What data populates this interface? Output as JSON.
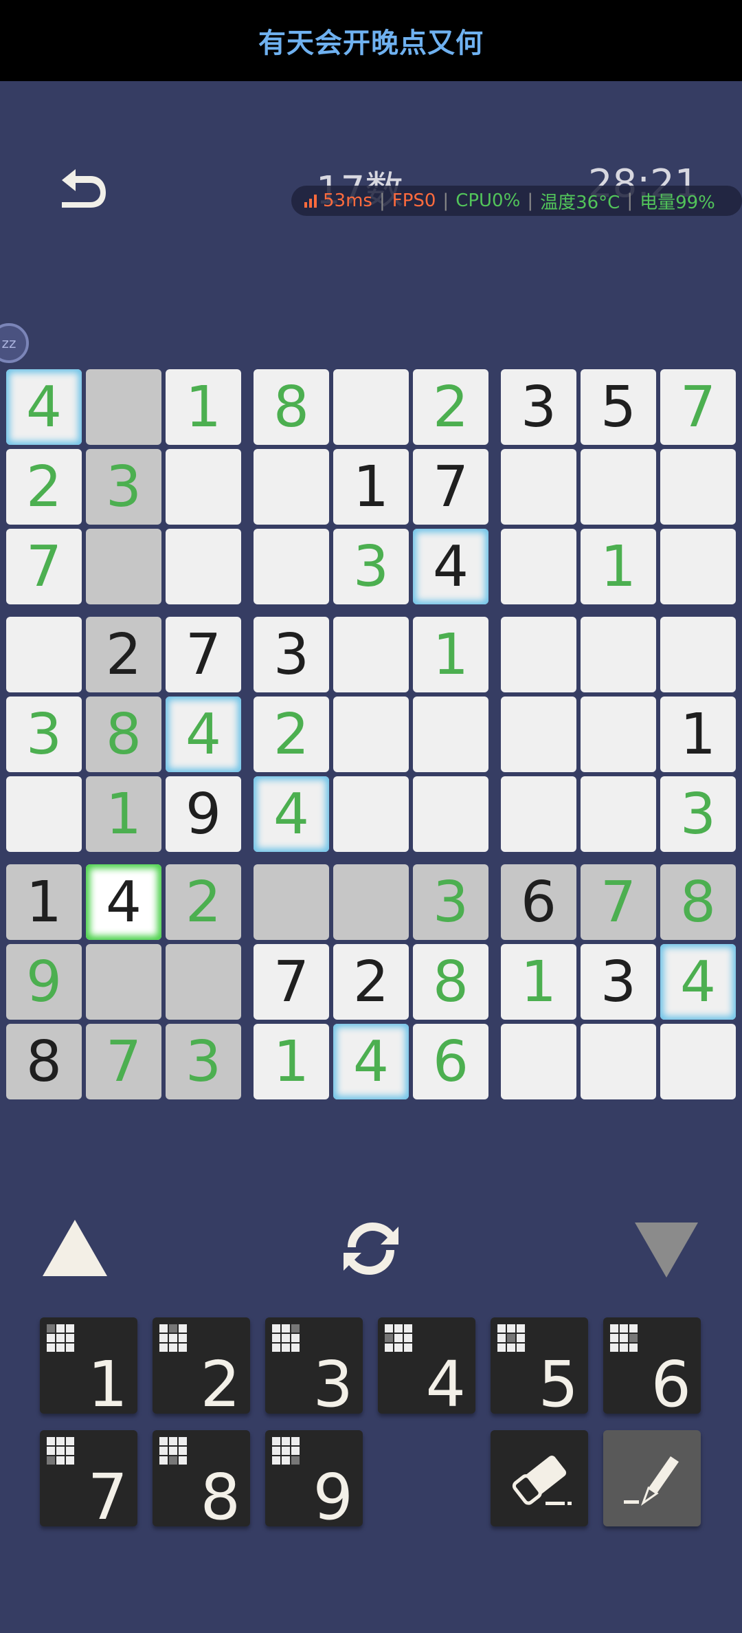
{
  "banner": {
    "text": "有天会开晚点又何"
  },
  "header": {
    "back_icon": "undo-arrow-icon",
    "title": "17数",
    "timer": "28:21"
  },
  "perf_overlay": {
    "ping": "53ms",
    "fps": "FPS0",
    "cpu": "CPU0%",
    "temp": "温度36°C",
    "battery": "电量99%"
  },
  "bubble": {
    "label": "zz"
  },
  "board": {
    "rows": [
      [
        "4",
        "",
        "1",
        "8",
        "",
        "2",
        "3",
        "5",
        "7"
      ],
      [
        "2",
        "3",
        "",
        "",
        "1",
        "7",
        "",
        "",
        ""
      ],
      [
        "7",
        "",
        "",
        "",
        "3",
        "4",
        "",
        "1",
        ""
      ],
      [
        "",
        "2",
        "7",
        "3",
        "",
        "1",
        "",
        "",
        ""
      ],
      [
        "3",
        "8",
        "4",
        "2",
        "",
        "",
        "",
        "",
        "1"
      ],
      [
        "",
        "1",
        "9",
        "4",
        "",
        "",
        "",
        "",
        "3"
      ],
      [
        "1",
        "4",
        "2",
        "",
        "",
        "3",
        "6",
        "7",
        "8"
      ],
      [
        "9",
        "",
        "",
        "7",
        "2",
        "8",
        "1",
        "3",
        "4"
      ],
      [
        "8",
        "7",
        "3",
        "1",
        "4",
        "6",
        "",
        "",
        ""
      ]
    ],
    "kinds": [
      [
        "u",
        "",
        "u",
        "u",
        "",
        "u",
        "g",
        "g",
        "u"
      ],
      [
        "u",
        "u",
        "",
        "",
        "g",
        "g",
        "",
        "",
        ""
      ],
      [
        "u",
        "",
        "",
        "",
        "u",
        "g",
        "",
        "u",
        ""
      ],
      [
        "",
        "g",
        "g",
        "g",
        "",
        "u",
        "",
        "",
        ""
      ],
      [
        "u",
        "u",
        "u",
        "u",
        "",
        "",
        "",
        "",
        "g"
      ],
      [
        "",
        "u",
        "g",
        "u",
        "",
        "",
        "",
        "",
        "u"
      ],
      [
        "g",
        "g",
        "u",
        "",
        "",
        "u",
        "g",
        "u",
        "u"
      ],
      [
        "u",
        "",
        "",
        "g",
        "g",
        "u",
        "u",
        "g",
        "u"
      ],
      [
        "g",
        "u",
        "u",
        "u",
        "u",
        "u",
        "",
        "",
        ""
      ]
    ],
    "shaded": [
      [
        0,
        1,
        0,
        0,
        0,
        0,
        0,
        0,
        0
      ],
      [
        0,
        1,
        0,
        0,
        0,
        0,
        0,
        0,
        0
      ],
      [
        0,
        1,
        0,
        0,
        0,
        0,
        0,
        0,
        0
      ],
      [
        0,
        1,
        0,
        0,
        0,
        0,
        0,
        0,
        0
      ],
      [
        0,
        1,
        0,
        0,
        0,
        0,
        0,
        0,
        0
      ],
      [
        0,
        1,
        0,
        0,
        0,
        0,
        0,
        0,
        0
      ],
      [
        1,
        1,
        1,
        1,
        1,
        1,
        1,
        1,
        1
      ],
      [
        1,
        1,
        1,
        0,
        0,
        0,
        0,
        0,
        0
      ],
      [
        1,
        1,
        1,
        0,
        0,
        0,
        0,
        0,
        0
      ]
    ],
    "highlighted": [
      [
        0,
        0
      ],
      [
        2,
        5
      ],
      [
        4,
        2
      ],
      [
        5,
        3
      ],
      [
        7,
        8
      ],
      [
        8,
        4
      ]
    ],
    "selected": [
      6,
      1
    ],
    "colors": {
      "given": "#1f1f1f",
      "user": "#4caf50",
      "highlight": "#6ec3e8",
      "selected": "#4ad14a"
    }
  },
  "controls": {
    "up_icon": "triangle-up-icon",
    "refresh_icon": "refresh-cycle-icon",
    "down_icon": "triangle-down-icon"
  },
  "keypad": {
    "keys": [
      "1",
      "2",
      "3",
      "4",
      "5",
      "6",
      "7",
      "8",
      "9"
    ],
    "eraser_icon": "eraser-icon",
    "pencil_icon": "pencil-icon"
  }
}
